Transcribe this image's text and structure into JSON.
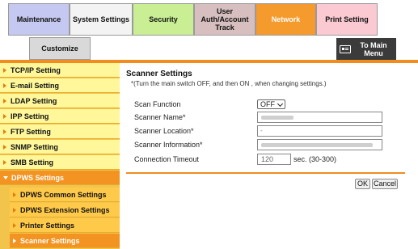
{
  "tabs": {
    "maintenance": "Maintenance",
    "system_settings": "System Settings",
    "security": "Security",
    "user_auth": [
      "User",
      "Auth/Account",
      "Track"
    ],
    "network": "Network",
    "print_setting": "Print Setting",
    "customize": "Customize",
    "to_main_menu": [
      "To Main",
      "Menu"
    ]
  },
  "sidebar": {
    "items": [
      {
        "label": "TCP/IP Setting"
      },
      {
        "label": "E-mail Setting"
      },
      {
        "label": "LDAP Setting"
      },
      {
        "label": "IPP Setting"
      },
      {
        "label": "FTP Setting"
      },
      {
        "label": "SNMP Setting"
      },
      {
        "label": "SMB Setting"
      },
      {
        "label": "DPWS Settings",
        "expanded": true
      }
    ],
    "subitems": [
      {
        "label": "DPWS Common Settings"
      },
      {
        "label": "DPWS Extension Settings"
      },
      {
        "label": "Printer Settings"
      },
      {
        "label": "Scanner Settings",
        "active": true
      }
    ]
  },
  "main": {
    "title": "Scanner Settings",
    "note": "*(Turn the main switch OFF, and then ON , when changing settings.)",
    "fields": {
      "scan_function": {
        "label": "Scan Function",
        "value": "OFF"
      },
      "scanner_name": {
        "label": "Scanner Name*"
      },
      "scanner_location": {
        "label": "Scanner Location*",
        "value": "-"
      },
      "scanner_information": {
        "label": "Scanner Information*"
      },
      "connection_timeout": {
        "label": "Connection Timeout",
        "value": "120",
        "unit": "sec. (30-300)"
      }
    },
    "buttons": {
      "ok": "OK",
      "cancel": "Cancel"
    }
  },
  "colors": {
    "accent_orange": "#f28c1f",
    "sidebar_yellow": "#fff79a",
    "sub_yellow": "#ffc94a"
  }
}
